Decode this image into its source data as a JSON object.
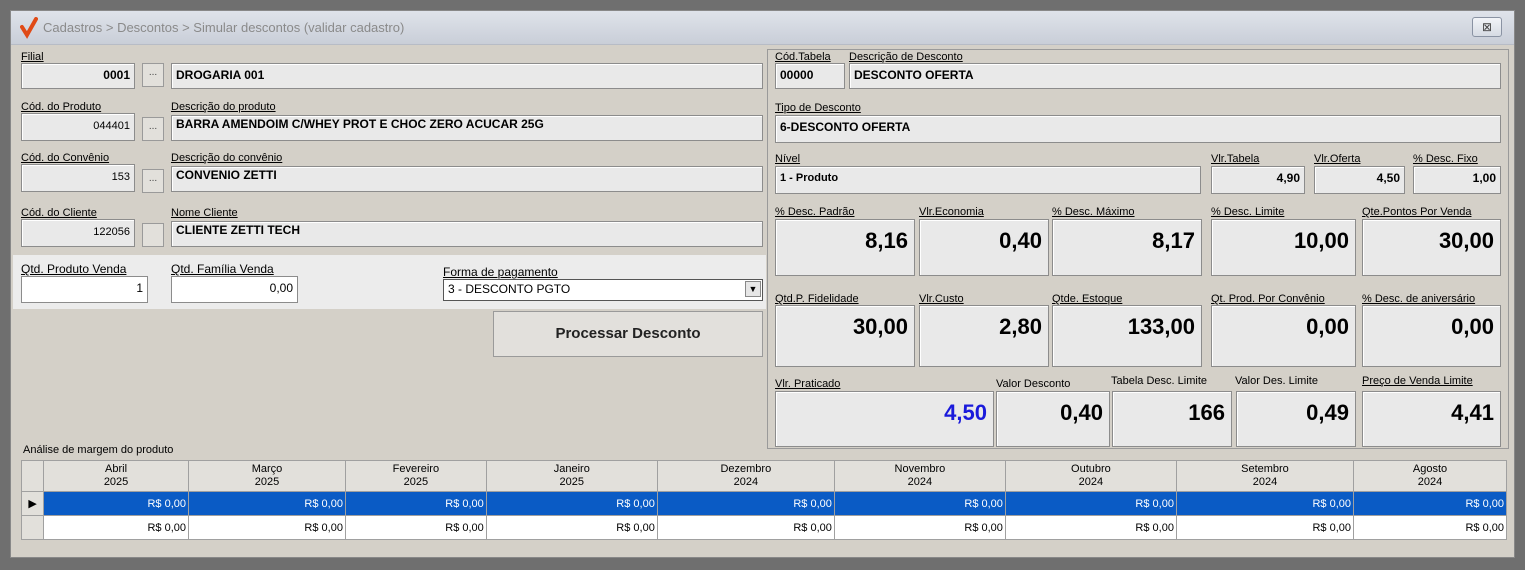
{
  "window": {
    "title": "Cadastros > Descontos > Simular descontos (validar cadastro)",
    "close": "⊠"
  },
  "left": {
    "filial": {
      "label": "Filial",
      "code": "0001",
      "name": "DROGARIA 001"
    },
    "produto": {
      "code_label": "Cód. do Produto",
      "desc_label": "Descrição  do produto",
      "code": "044401",
      "name": "BARRA AMENDOIM C/WHEY PROT E CHOC ZERO ACUCAR 25G"
    },
    "convenio": {
      "code_label": "Cód. do Convênio",
      "desc_label": "Descrição  do convênio",
      "code": "153",
      "name": "CONVENIO ZETTI"
    },
    "cliente": {
      "code_label": "Cód. do Cliente",
      "desc_label": "Nome Cliente",
      "code": "122056",
      "name": "CLIENTE ZETTI TECH"
    },
    "dots": "...",
    "qtd_produto": {
      "label": "Qtd. Produto Venda",
      "value": "1"
    },
    "qtd_familia": {
      "label": "Qtd. Família Venda",
      "value": "0,00"
    },
    "forma_pagamento": {
      "label": "Forma de pagamento",
      "value": "3 - DESCONTO PGTO"
    },
    "processar": "Processar Desconto"
  },
  "right": {
    "cod_tabela": {
      "label": "Cód.Tabela",
      "value": "00000"
    },
    "desc_desconto": {
      "label": "Descrição de Desconto",
      "value": "DESCONTO OFERTA"
    },
    "tipo": {
      "label": "Tipo de Desconto",
      "value": "6-DESCONTO OFERTA"
    },
    "nivel": {
      "label": "Nível",
      "value": "1 - Produto"
    },
    "vl_tabela": {
      "label": "Vlr.Tabela",
      "value": "4,90"
    },
    "vl_oferta": {
      "label": "Vlr.Oferta",
      "value": "4,50"
    },
    "desc_fixo": {
      "label": "% Desc. Fixo",
      "value": "1,00"
    },
    "row1": [
      {
        "label": "% Desc. Padrão",
        "value": "8,16"
      },
      {
        "label": "Vlr.Economia",
        "value": "0,40"
      },
      {
        "label": "% Desc. Máximo",
        "value": "8,17"
      },
      {
        "label": "% Desc. Limite",
        "value": "10,00"
      },
      {
        "label": "Qte.Pontos Por Venda",
        "value": "30,00"
      }
    ],
    "row2": [
      {
        "label": "Qtd.P. Fidelidade",
        "value": "30,00"
      },
      {
        "label": "Vlr.Custo",
        "value": "2,80"
      },
      {
        "label": "Qtde. Estoque",
        "value": "133,00"
      },
      {
        "label": "Qt. Prod. Por Convênio",
        "value": "0,00"
      },
      {
        "label": "% Desc. de aniversário",
        "value": "0,00"
      }
    ],
    "row3": [
      {
        "label": "Vlr. Praticado",
        "value": "4,50"
      },
      {
        "label": "Valor Desconto",
        "value": "0,40"
      },
      {
        "label": "Tabela Desc. Limite",
        "value": "166"
      },
      {
        "label": "Valor Des. Limite",
        "value": "0,49"
      },
      {
        "label": "Preço de Venda Limite",
        "value": "4,41"
      }
    ],
    "praticado_color": "#1a1adb"
  },
  "grid": {
    "title": "Análise de margem do produto",
    "columns": [
      {
        "month": "Abril",
        "year": "2025"
      },
      {
        "month": "Março",
        "year": "2025"
      },
      {
        "month": "Fevereiro",
        "year": "2025"
      },
      {
        "month": "Janeiro",
        "year": "2025"
      },
      {
        "month": "Dezembro",
        "year": "2024"
      },
      {
        "month": "Novembro",
        "year": "2024"
      },
      {
        "month": "Outubro",
        "year": "2024"
      },
      {
        "month": "Setembro",
        "year": "2024"
      },
      {
        "month": "Agosto",
        "year": "2024"
      }
    ],
    "rows": [
      {
        "selected": true,
        "values": [
          "R$ 0,00",
          "R$ 0,00",
          "R$ 0,00",
          "R$ 0,00",
          "R$ 0,00",
          "R$ 0,00",
          "R$ 0,00",
          "R$ 0,00",
          "R$ 0,00"
        ]
      },
      {
        "selected": false,
        "values": [
          "R$ 0,00",
          "R$ 0,00",
          "R$ 0,00",
          "R$ 0,00",
          "R$ 0,00",
          "R$ 0,00",
          "R$ 0,00",
          "R$ 0,00",
          "R$ 0,00"
        ]
      }
    ],
    "selected_color": "#0a5bc5"
  }
}
